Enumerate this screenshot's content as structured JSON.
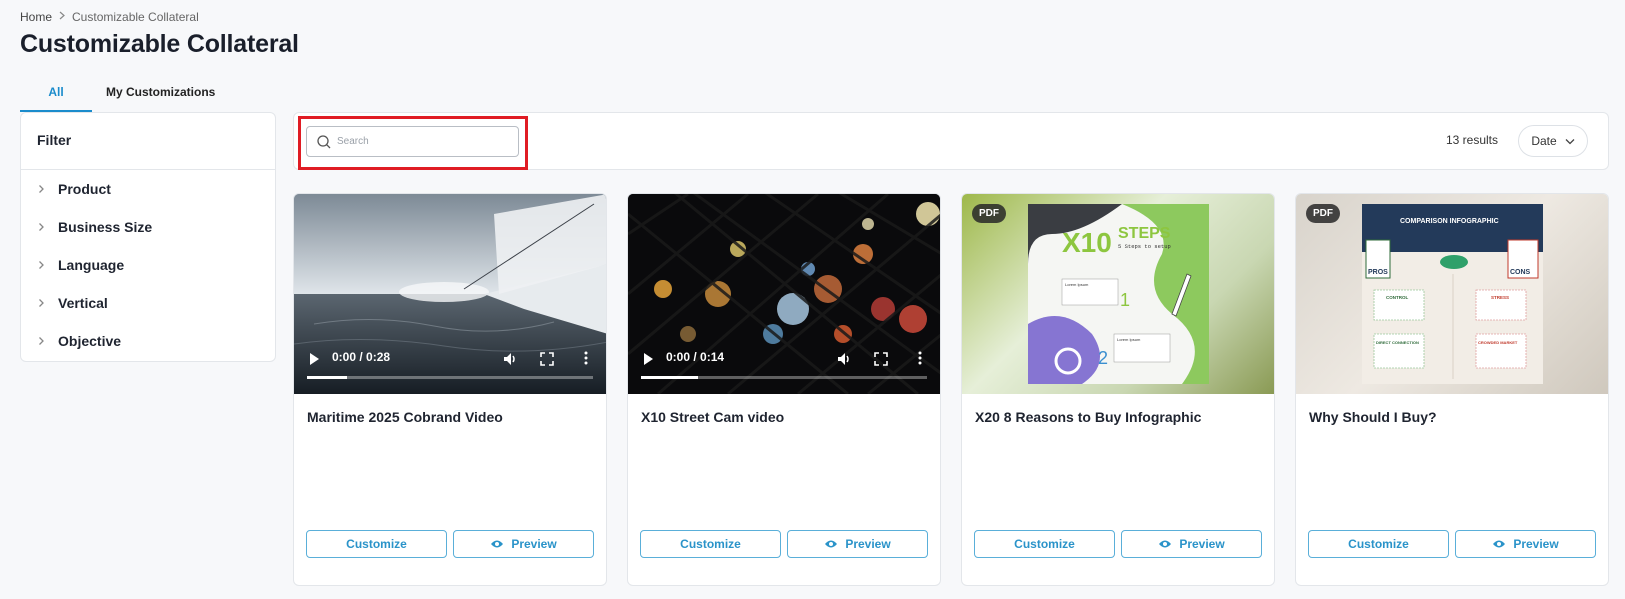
{
  "breadcrumb": {
    "home": "Home",
    "current": "Customizable Collateral"
  },
  "page": {
    "title": "Customizable Collateral"
  },
  "tabs": [
    {
      "label": "All",
      "active": true
    },
    {
      "label": "My Customizations",
      "active": false
    }
  ],
  "filter": {
    "title": "Filter",
    "items": [
      "Product",
      "Business Size",
      "Language",
      "Vertical",
      "Objective"
    ]
  },
  "toolbar": {
    "search_placeholder": "Search",
    "results_text": "13 results",
    "sort_label": "Date"
  },
  "cards": [
    {
      "title": "Maritime 2025 Cobrand Video",
      "type": "video",
      "time": "0:00 / 0:28",
      "progress": 0.14,
      "customize": "Customize",
      "preview": "Preview"
    },
    {
      "title": "X10 Street Cam video",
      "type": "video",
      "time": "0:00 / 0:14",
      "progress": 0.2,
      "customize": "Customize",
      "preview": "Preview"
    },
    {
      "title": "X20 8 Reasons to Buy Infographic",
      "type": "pdf",
      "badge": "PDF",
      "customize": "Customize",
      "preview": "Preview",
      "thumb_text": {
        "headline": "X10",
        "headline2": "STEPS",
        "sub": "5 Steps to setup",
        "step1": "1",
        "step2": "2",
        "lorem": "Lorem Ipsum"
      }
    },
    {
      "title": "Why Should I Buy?",
      "type": "pdf",
      "badge": "PDF",
      "customize": "Customize",
      "preview": "Preview",
      "thumb_text": {
        "headline": "COMPARISON INFOGRAPHIC",
        "pros": "PROS",
        "cons": "CONS",
        "control": "CONTROL",
        "stress": "STRESS",
        "direct": "DIRECT CONNECTION",
        "crowded": "CROWDED MARKET"
      }
    }
  ],
  "colors": {
    "accent": "#1b8ccc",
    "highlight": "#e01c24",
    "button_border": "#5aafd9"
  }
}
